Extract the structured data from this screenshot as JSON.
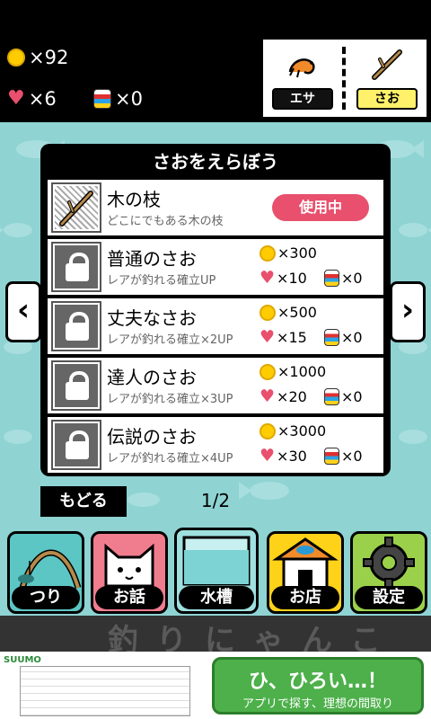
{
  "header": {
    "coins": "×92",
    "hearts": "×6",
    "cans": "×0",
    "equip": {
      "bait_label": "エサ",
      "rod_label": "さお"
    }
  },
  "panel": {
    "title": "さおをえらぼう",
    "rods": [
      {
        "name": "木の枝",
        "desc": "どこにでもある木の枝",
        "status": "使用中",
        "locked": false
      },
      {
        "name": "普通のさお",
        "desc": "レアが釣れる確立UP",
        "coins": "×300",
        "hearts": "×10",
        "cans": "×0",
        "locked": true
      },
      {
        "name": "丈夫なさお",
        "desc": "レアが釣れる確立×2UP",
        "coins": "×500",
        "hearts": "×15",
        "cans": "×0",
        "locked": true
      },
      {
        "name": "達人のさお",
        "desc": "レアが釣れる確立×3UP",
        "coins": "×1000",
        "hearts": "×20",
        "cans": "×0",
        "locked": true
      },
      {
        "name": "伝説のさお",
        "desc": "レアが釣れる確立×4UP",
        "coins": "×3000",
        "hearts": "×30",
        "cans": "×0",
        "locked": true
      }
    ],
    "prev_arrow": "‹",
    "next_arrow": "›"
  },
  "nav": {
    "back_label": "もどる",
    "page": "1/2"
  },
  "tabs": [
    {
      "label": "つり",
      "color": "#5cc6c4"
    },
    {
      "label": "お話",
      "color": "#f07d8e"
    },
    {
      "label": "水槽",
      "color": "#9fe0e0"
    },
    {
      "label": "お店",
      "color": "#ffd21a"
    },
    {
      "label": "設定",
      "color": "#9bd14a"
    }
  ],
  "band": {
    "text": "釣りにゃんこ"
  },
  "ad": {
    "brand": "SUUMO",
    "headline": "ひ、ひろい…！",
    "subline": "アプリで探す、理想の間取り"
  }
}
